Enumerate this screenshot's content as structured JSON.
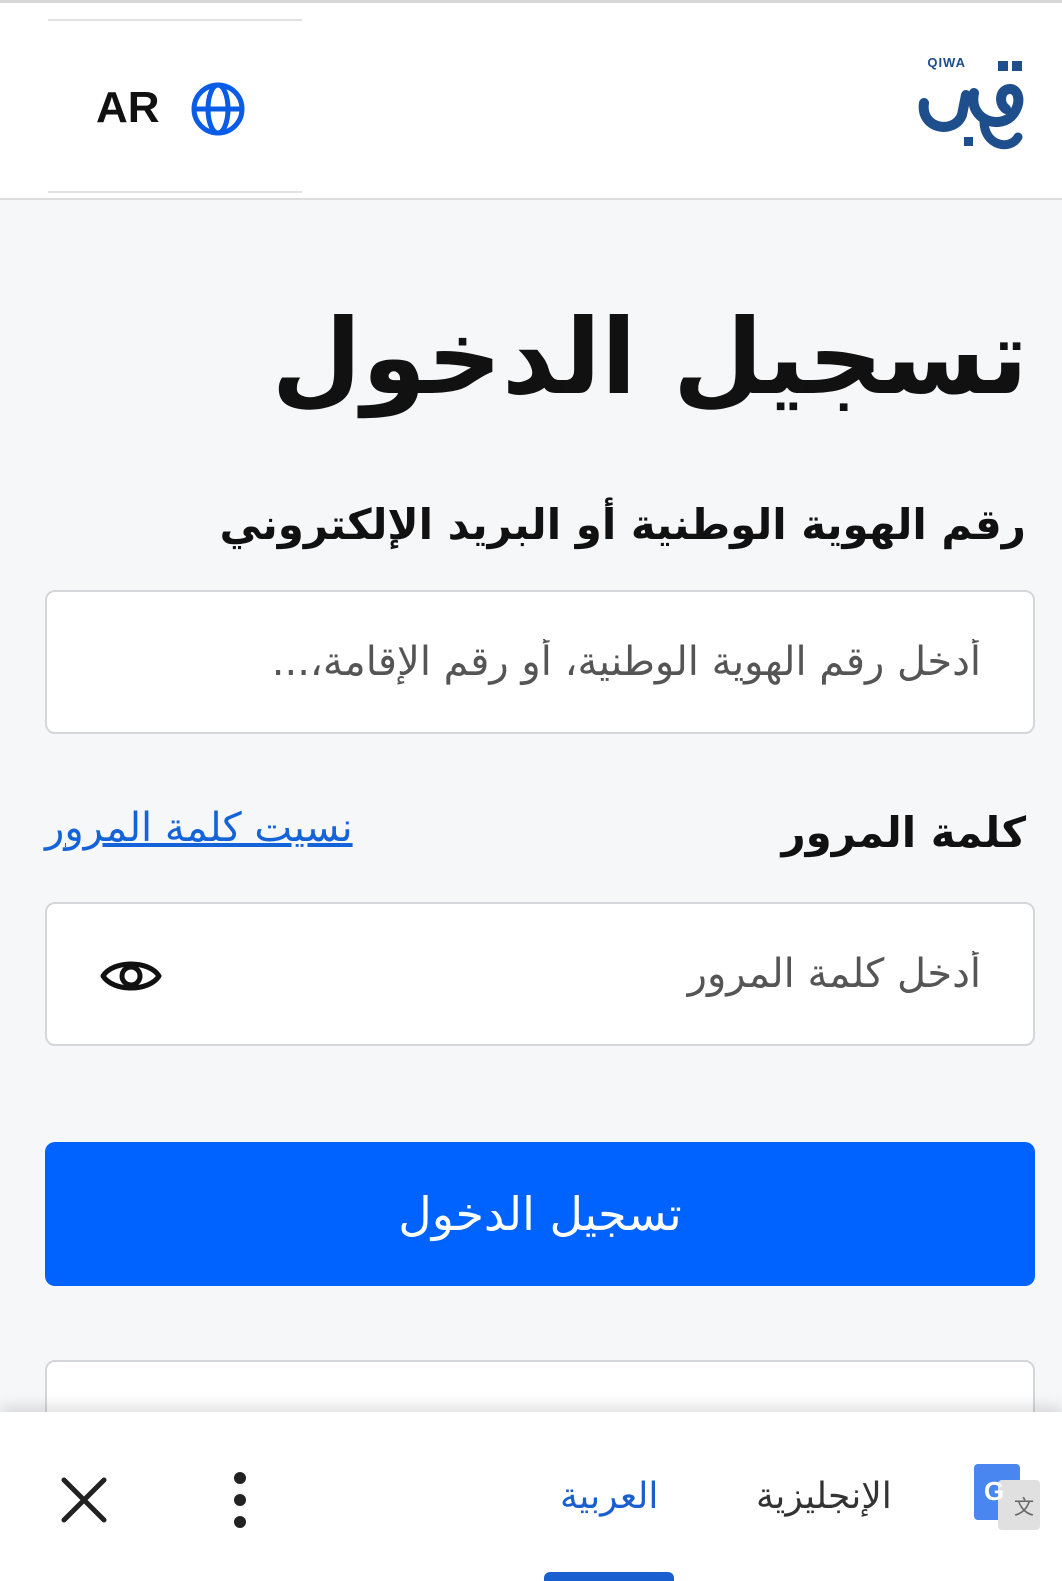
{
  "header": {
    "language_code": "AR",
    "logo_text": "QIWA"
  },
  "main": {
    "title": "تسجيل الدخول",
    "id_field": {
      "label": "رقم الهوية الوطنية أو البريد الإلكتروني",
      "placeholder": "أدخل رقم الهوية الوطنية، أو رقم الإقامة،..."
    },
    "password_field": {
      "label": "كلمة المرور",
      "placeholder": "أدخل كلمة المرور",
      "forgot_link": "نسيت كلمة المرور"
    },
    "login_button": "تسجيل الدخول"
  },
  "translate_bar": {
    "target_language": "العربية",
    "source_language": "الإنجليزية"
  },
  "colors": {
    "primary": "#0062ff",
    "link": "#1463d8",
    "logo": "#1f4e8c",
    "translate_active": "#1a5fcf"
  }
}
